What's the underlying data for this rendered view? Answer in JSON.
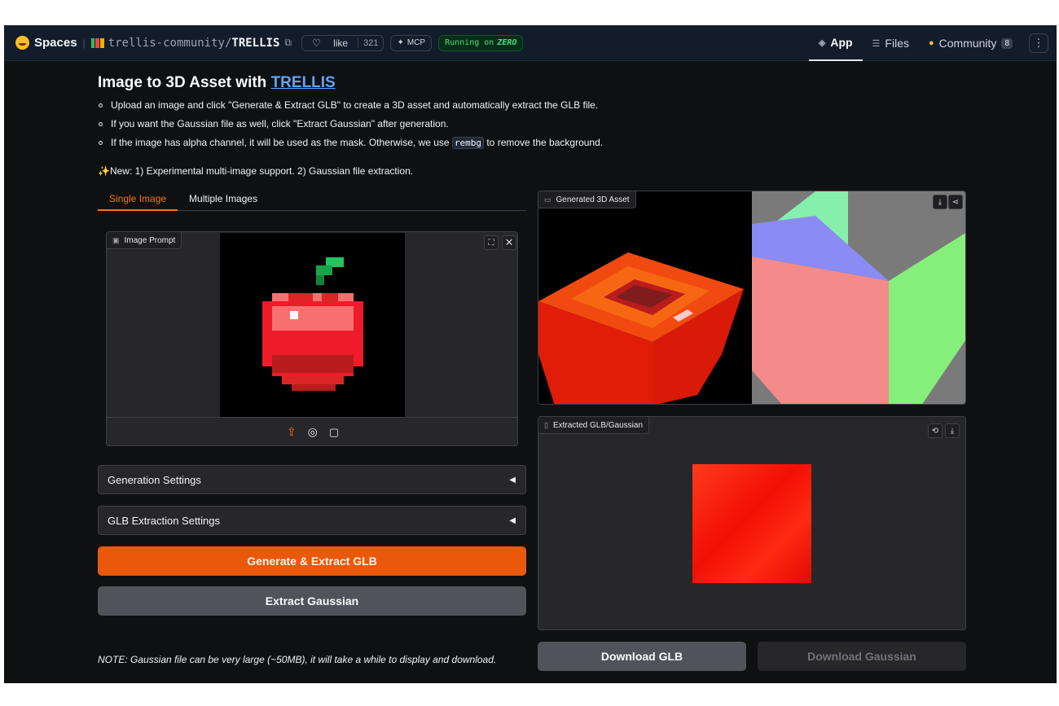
{
  "nav": {
    "brand": "Spaces",
    "repo_owner": "trellis-community/",
    "repo_name": "TRELLIS",
    "like_label": "like",
    "like_count": "321",
    "mcp_label": "MCP",
    "running_label": "Running on",
    "running_hw": "ZERO",
    "tabs": [
      {
        "label": "App"
      },
      {
        "label": "Files"
      },
      {
        "label": "Community",
        "badge": "8"
      }
    ]
  },
  "header": {
    "title_prefix": "Image to 3D Asset with ",
    "title_link": "TRELLIS"
  },
  "bullets": [
    {
      "text": "Upload an image and click \"Generate & Extract GLB\" to create a 3D asset and automatically extract the GLB file."
    },
    {
      "text": "If you want the Gaussian file as well, click \"Extract Gaussian\" after generation."
    },
    {
      "before": "If the image has alpha channel, it will be used as the mask. Otherwise, we use ",
      "code": "rembg",
      "after": " to remove the background."
    }
  ],
  "news": "New: 1) Experimental multi-image support. 2) Gaussian file extraction.",
  "tabs": [
    "Single Image",
    "Multiple Images"
  ],
  "image_prompt": {
    "label": "Image Prompt"
  },
  "generated": {
    "label": "Generated 3D Asset"
  },
  "extracted": {
    "label": "Extracted GLB/Gaussian"
  },
  "accordions": [
    "Generation Settings",
    "GLB Extraction Settings"
  ],
  "buttons": {
    "generate": "Generate & Extract GLB",
    "extract_gaussian": "Extract Gaussian",
    "download_glb": "Download GLB",
    "download_gaussian": "Download Gaussian"
  },
  "note": "NOTE: Gaussian file can be very large (~50MB), it will take a while to display and download.",
  "colors": {
    "accent": "#ea580c",
    "link": "#60a5fa",
    "running": "#4ade80"
  }
}
